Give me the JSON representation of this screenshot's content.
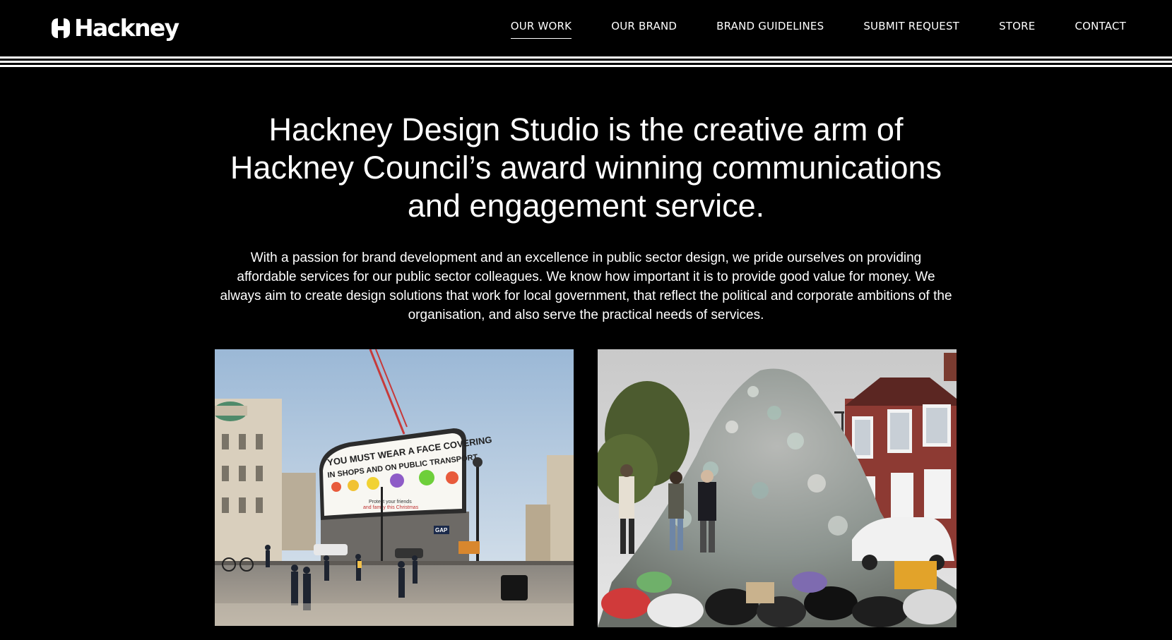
{
  "header": {
    "logo_text": "Hackney",
    "nav": [
      {
        "label": "OUR WORK",
        "active": true
      },
      {
        "label": "OUR BRAND",
        "active": false
      },
      {
        "label": "BRAND GUIDELINES",
        "active": false
      },
      {
        "label": "SUBMIT REQUEST",
        "active": false
      },
      {
        "label": "STORE",
        "active": false
      },
      {
        "label": "CONTACT",
        "active": false
      }
    ]
  },
  "hero": {
    "headline_lines": [
      "Hackney Design Studio is the creative arm of",
      "Hackney Council’s award winning communications",
      "and engagement service."
    ],
    "intro_lines": [
      "With a passion for brand development and an excellence in public sector design, we pride ourselves on providing",
      "affordable services for our public sector colleagues. We know how important it is to provide good value for money. We",
      "always aim to create design solutions that work for local government, that reflect the political and corporate ambitions of the",
      "organisation, and also serve the practical needs of services."
    ]
  },
  "gallery": {
    "billboard": {
      "headline_lines": [
        "YOU MUST WEAR A FACE COVERING",
        "IN SHOPS AND ON PUBLIC TRANSPORT"
      ],
      "footer_line_1": "Protect your friends",
      "footer_line_2": "and family this Christmas",
      "shop_sign": "GAP"
    }
  },
  "colors": {
    "background": "#000000",
    "text": "#ffffff"
  }
}
